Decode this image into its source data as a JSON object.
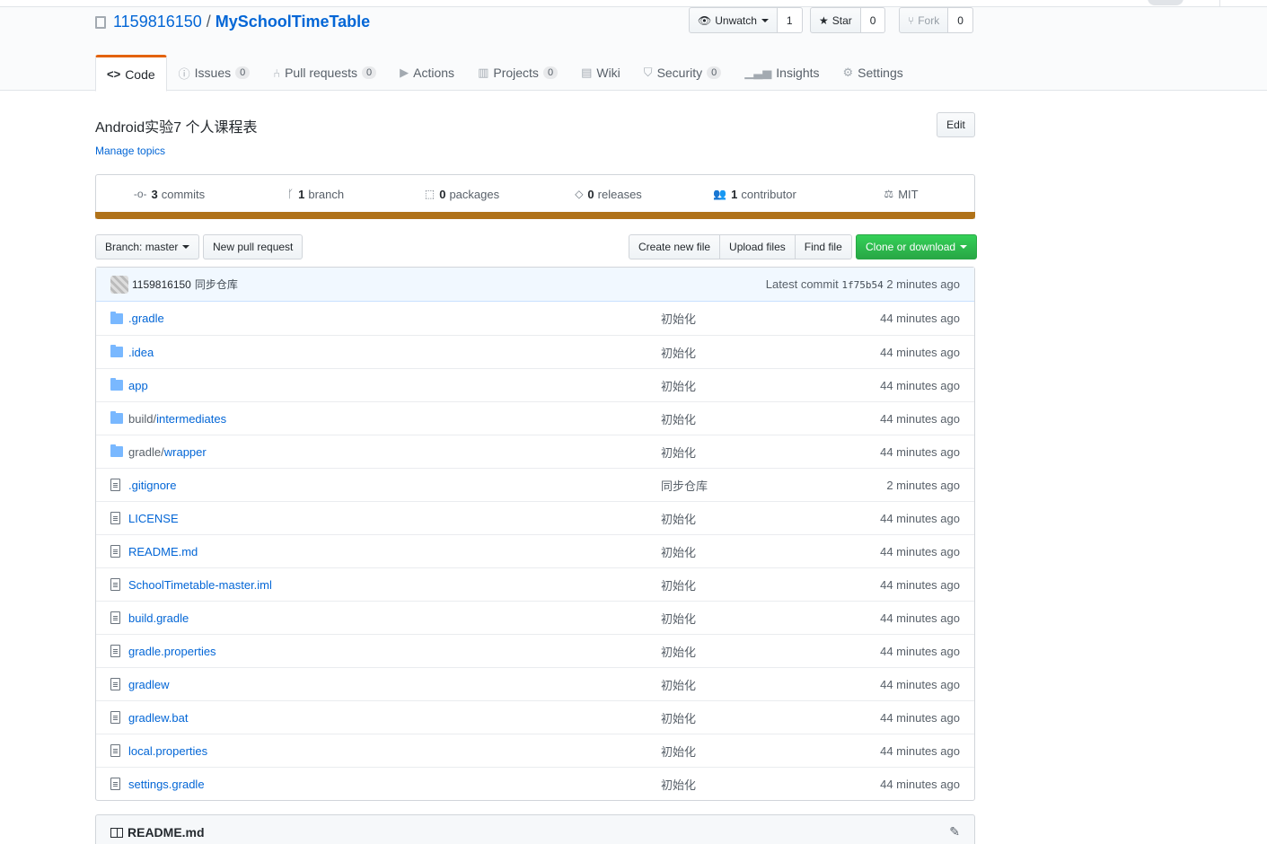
{
  "repo": {
    "owner": "1159816150",
    "separator": "/",
    "name": "MySchoolTimeTable"
  },
  "actions": {
    "watch_label": "Unwatch",
    "watch_count": "1",
    "star_label": "Star",
    "star_count": "0",
    "fork_label": "Fork",
    "fork_count": "0"
  },
  "tabs": [
    {
      "label": "Code",
      "icon": "<>"
    },
    {
      "label": "Issues",
      "count": "0"
    },
    {
      "label": "Pull requests",
      "count": "0"
    },
    {
      "label": "Actions"
    },
    {
      "label": "Projects",
      "count": "0"
    },
    {
      "label": "Wiki"
    },
    {
      "label": "Security",
      "count": "0"
    },
    {
      "label": "Insights"
    },
    {
      "label": "Settings"
    }
  ],
  "about": {
    "description": "Android实验7 个人课程表",
    "edit_label": "Edit",
    "manage_topics": "Manage topics"
  },
  "summary": {
    "commits_num": "3",
    "commits_label": "commits",
    "branch_num": "1",
    "branch_label": "branch",
    "packages_num": "0",
    "packages_label": "packages",
    "releases_num": "0",
    "releases_label": "releases",
    "contributor_num": "1",
    "contributor_label": "contributor",
    "license": "MIT",
    "language_color": "#b07219"
  },
  "filenav": {
    "branch_label": "Branch: master",
    "new_pr": "New pull request",
    "create_file": "Create new file",
    "upload_files": "Upload files",
    "find_file": "Find file",
    "clone": "Clone or download"
  },
  "latest_commit": {
    "author": "1159816150",
    "message": "同步仓库",
    "latest_label": "Latest commit",
    "sha": "1f75b54",
    "age": "2 minutes ago"
  },
  "files": [
    {
      "type": "dir",
      "prefix": "",
      "name": ".gradle",
      "message": "初始化",
      "age": "44 minutes ago"
    },
    {
      "type": "dir",
      "prefix": "",
      "name": ".idea",
      "message": "初始化",
      "age": "44 minutes ago"
    },
    {
      "type": "dir",
      "prefix": "",
      "name": "app",
      "message": "初始化",
      "age": "44 minutes ago"
    },
    {
      "type": "dir",
      "prefix": "build/",
      "name": "intermediates",
      "message": "初始化",
      "age": "44 minutes ago"
    },
    {
      "type": "dir",
      "prefix": "gradle/",
      "name": "wrapper",
      "message": "初始化",
      "age": "44 minutes ago"
    },
    {
      "type": "file",
      "prefix": "",
      "name": ".gitignore",
      "message": "同步仓库",
      "age": "2 minutes ago"
    },
    {
      "type": "file",
      "prefix": "",
      "name": "LICENSE",
      "message": "初始化",
      "age": "44 minutes ago"
    },
    {
      "type": "file",
      "prefix": "",
      "name": "README.md",
      "message": "初始化",
      "age": "44 minutes ago"
    },
    {
      "type": "file",
      "prefix": "",
      "name": "SchoolTimetable-master.iml",
      "message": "初始化",
      "age": "44 minutes ago"
    },
    {
      "type": "file",
      "prefix": "",
      "name": "build.gradle",
      "message": "初始化",
      "age": "44 minutes ago"
    },
    {
      "type": "file",
      "prefix": "",
      "name": "gradle.properties",
      "message": "初始化",
      "age": "44 minutes ago"
    },
    {
      "type": "file",
      "prefix": "",
      "name": "gradlew",
      "message": "初始化",
      "age": "44 minutes ago"
    },
    {
      "type": "file",
      "prefix": "",
      "name": "gradlew.bat",
      "message": "初始化",
      "age": "44 minutes ago"
    },
    {
      "type": "file",
      "prefix": "",
      "name": "local.properties",
      "message": "初始化",
      "age": "44 minutes ago"
    },
    {
      "type": "file",
      "prefix": "",
      "name": "settings.gradle",
      "message": "初始化",
      "age": "44 minutes ago"
    }
  ],
  "readme": {
    "title": "README.md"
  }
}
